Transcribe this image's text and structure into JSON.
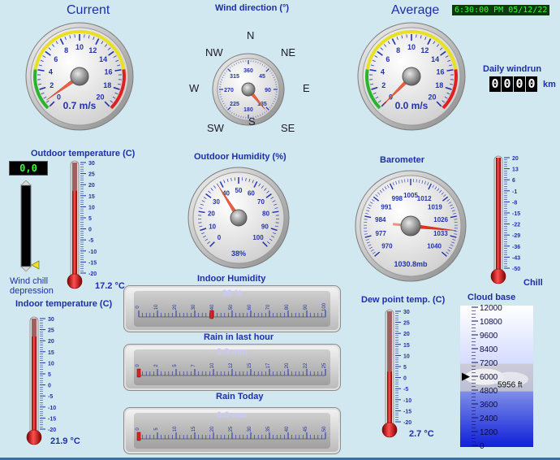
{
  "header": {
    "current": "Current",
    "wind_direction": "Wind direction (°)",
    "average": "Average",
    "clock": "6:30:00 PM 05/12/22"
  },
  "wind_current": {
    "ticks": [
      "0",
      "2",
      "4",
      "6",
      "8",
      "10",
      "12",
      "14",
      "16",
      "18",
      "20"
    ],
    "value": 0.7,
    "readout": "0.7 m/s"
  },
  "wind_average": {
    "ticks": [
      "0",
      "2",
      "4",
      "6",
      "8",
      "10",
      "12",
      "14",
      "16",
      "18",
      "20"
    ],
    "value": 0.0,
    "readout": "0.0 m/s"
  },
  "compass": {
    "N": "N",
    "NE": "NE",
    "E": "E",
    "SE": "SE",
    "S": "S",
    "SW": "SW",
    "W": "W",
    "NW": "NW",
    "ticks": [
      "360",
      "45",
      "90",
      "135",
      "180",
      "225",
      "270",
      "315"
    ],
    "direction_deg": 140
  },
  "windrun": {
    "label": "Daily windrun",
    "digits": [
      "0",
      "0",
      "0",
      "0"
    ],
    "unit": "km"
  },
  "outdoor_temp": {
    "label": "Outdoor temperature (C)",
    "scale": [
      "30",
      "25",
      "20",
      "15",
      "10",
      "5",
      "0",
      "-5",
      "-10",
      "-15",
      "-20"
    ],
    "min": -20,
    "max": 30,
    "value": 17.2,
    "readout": "17.2 °C"
  },
  "windchill": {
    "lcd": "0,0",
    "label_line1": "Wind chill",
    "label_line2": "depression"
  },
  "outdoor_humidity": {
    "label": "Outdoor Humidity (%)",
    "ticks": [
      "0",
      "10",
      "20",
      "30",
      "40",
      "50",
      "60",
      "70",
      "80",
      "90",
      "100"
    ],
    "value": 38,
    "readout": "38%"
  },
  "barometer": {
    "label": "Barometer",
    "ticks": [
      "970",
      "977",
      "984",
      "991",
      "998",
      "1005",
      "1012",
      "1019",
      "1026",
      "1033",
      "1040"
    ],
    "min": 970,
    "max": 1040,
    "value": 1030.8,
    "readout": "1030.8mb"
  },
  "chill": {
    "label": "Chill",
    "scale": [
      "20",
      "13",
      "6",
      "-1",
      "-8",
      "-15",
      "-22",
      "-29",
      "-36",
      "-43",
      "-50"
    ],
    "min": -50,
    "max": 20,
    "value": 20
  },
  "indoor_temp": {
    "label": "Indoor temperature (C)",
    "scale": [
      "30",
      "25",
      "20",
      "15",
      "10",
      "5",
      "0",
      "-5",
      "-10",
      "-15",
      "-20"
    ],
    "min": -20,
    "max": 30,
    "value": 21.9,
    "readout": "21.9 °C"
  },
  "indoor_humidity": {
    "label": "Indoor Humidity",
    "readout": "39 %",
    "ticks": [
      "0",
      "10",
      "20",
      "30",
      "40",
      "50",
      "60",
      "70",
      "80",
      "90",
      "100"
    ],
    "min": 0,
    "max": 100,
    "value": 39
  },
  "rain_hour": {
    "label": "Rain in last hour",
    "readout": "0.0 mm",
    "ticks": [
      "0",
      "2",
      "5",
      "7",
      "10",
      "12",
      "15",
      "17",
      "20",
      "22",
      "25"
    ],
    "min": 0,
    "max": 25,
    "value": 0
  },
  "rain_today": {
    "label": "Rain Today",
    "readout": "0.0 mm",
    "ticks": [
      "0",
      "5",
      "10",
      "15",
      "20",
      "25",
      "30",
      "35",
      "40",
      "45",
      "50"
    ],
    "min": 0,
    "max": 50,
    "value": 0
  },
  "dew_point": {
    "label": "Dew point temp. (C)",
    "scale": [
      "30",
      "25",
      "20",
      "15",
      "10",
      "5",
      "0",
      "-5",
      "-10",
      "-15",
      "-20"
    ],
    "min": -20,
    "max": 30,
    "value": 2.7,
    "readout": "2.7 °C"
  },
  "cloud_base": {
    "label": "Cloud base",
    "scale": [
      "12000",
      "10800",
      "9600",
      "8400",
      "7200",
      "6000",
      "4800",
      "3600",
      "2400",
      "1200",
      "0"
    ],
    "min": 0,
    "max": 12000,
    "value": 5956,
    "readout": "5956 ft"
  },
  "colors": {
    "label_blue": "#1c2fa8",
    "background": "#d2e8f0",
    "needle": "#e8503a",
    "mercury": "#d01010"
  }
}
